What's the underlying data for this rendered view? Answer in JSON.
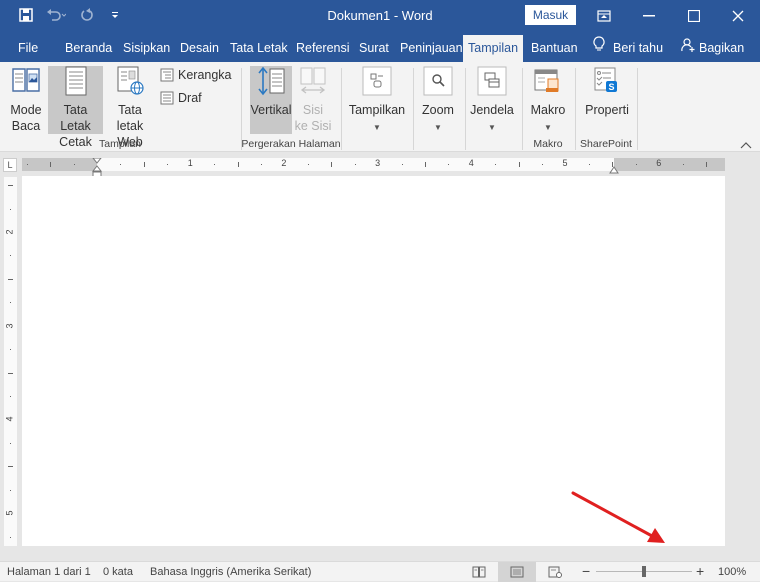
{
  "titlebar": {
    "title": "Dokumen1  -  Word",
    "sign_in_label": "Masuk",
    "quick_access": [
      "save",
      "undo",
      "redo",
      "customize"
    ]
  },
  "tabs": [
    {
      "label": "File",
      "active": false
    },
    {
      "label": "Beranda",
      "active": false
    },
    {
      "label": "Sisipkan",
      "active": false
    },
    {
      "label": "Desain",
      "active": false
    },
    {
      "label": "Tata Letak",
      "active": false
    },
    {
      "label": "Referensi",
      "active": false
    },
    {
      "label": "Surat",
      "active": false
    },
    {
      "label": "Peninjauan",
      "active": false
    },
    {
      "label": "Tampilan",
      "active": true
    },
    {
      "label": "Bantuan",
      "active": false
    }
  ],
  "tell_me": "Beri tahu",
  "share": "Bagikan",
  "ribbon": {
    "groups": {
      "tampilan": {
        "label": "Tampilan",
        "mode_baca": "Mode Baca",
        "mode_baca_l1": "Mode",
        "mode_baca_l2": "Baca",
        "tata_letak_cetak_l1": "Tata Letak",
        "tata_letak_cetak_l2": "Cetak",
        "tata_letak_web_l1": "Tata letak",
        "tata_letak_web_l2": "Web",
        "kerangka": "Kerangka",
        "draf": "Draf"
      },
      "pergerakan": {
        "label": "Pergerakan Halaman",
        "vertikal": "Vertikal",
        "sisi_l1": "Sisi",
        "sisi_l2": "ke Sisi"
      },
      "tampilkan": {
        "label": "Tampilkan"
      },
      "zoom": {
        "label": "Zoom"
      },
      "jendela": {
        "label": "Jendela"
      },
      "makro": {
        "button": "Makro",
        "label": "Makro"
      },
      "sharepoint": {
        "button": "Properti",
        "label": "SharePoint"
      }
    }
  },
  "ruler": {
    "corner": "L",
    "h_labels": [
      "1",
      "2",
      "3",
      "4",
      "5",
      "6"
    ],
    "v_labels": [
      "2",
      "3",
      "4",
      "5"
    ]
  },
  "status": {
    "page": "Halaman 1 dari 1",
    "words": "0 kata",
    "language": "Bahasa Inggris (Amerika Serikat)",
    "zoom_level": "100%",
    "zoom_percent": 100
  },
  "annotation": {
    "color": "#e02020",
    "points_to": "zoom-slider"
  }
}
